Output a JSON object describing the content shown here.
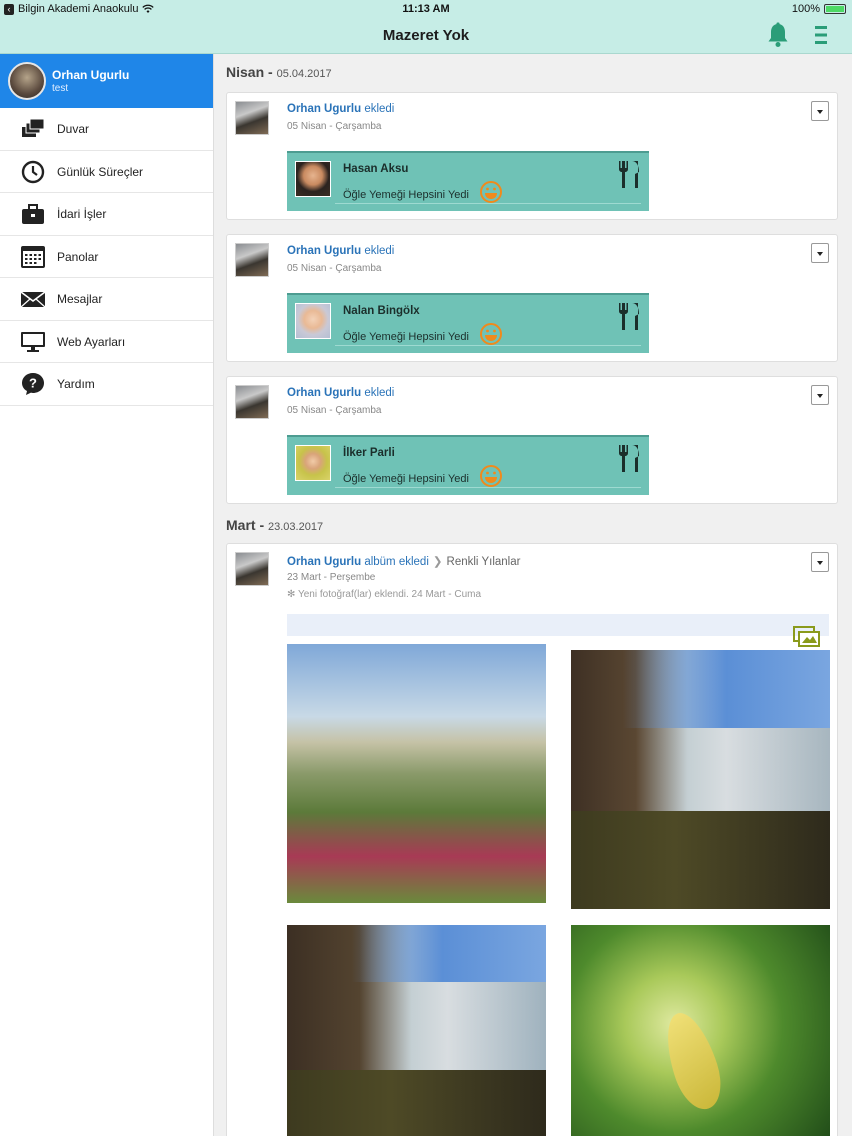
{
  "status_bar": {
    "back_text": "Bilgin Akademi Anaokulu",
    "time": "11:13 AM",
    "battery": "100%"
  },
  "nav": {
    "title": "Mazeret Yok"
  },
  "profile": {
    "name": "Orhan Ugurlu",
    "subtitle": "test"
  },
  "sidebar": {
    "items": [
      {
        "label": "Duvar",
        "icon": "wall-icon"
      },
      {
        "label": "Günlük Süreçler",
        "icon": "clock-icon"
      },
      {
        "label": "İdari İşler",
        "icon": "briefcase-icon"
      },
      {
        "label": "Panolar",
        "icon": "calendar-icon"
      },
      {
        "label": "Mesajlar",
        "icon": "envelope-icon"
      },
      {
        "label": "Web Ayarları",
        "icon": "monitor-icon"
      },
      {
        "label": "Yardım",
        "icon": "help-icon"
      }
    ]
  },
  "feed": {
    "sections": [
      {
        "month": "Nisan",
        "sep": " - ",
        "date": "05.04.2017"
      },
      {
        "month": "Mart",
        "sep": " - ",
        "date": "23.03.2017"
      }
    ],
    "posts": [
      {
        "author": "Orhan Ugurlu",
        "action": " ekledi",
        "when": "05 Nisan - Çarşamba",
        "child": "Hasan Aksu",
        "status": "Öğle Yemeği Hepsini Yedi"
      },
      {
        "author": "Orhan Ugurlu",
        "action": " ekledi",
        "when": "05 Nisan - Çarşamba",
        "child": "Nalan Bingölx",
        "status": "Öğle Yemeği Hepsini Yedi"
      },
      {
        "author": "Orhan Ugurlu",
        "action": " ekledi",
        "when": "05 Nisan - Çarşamba",
        "child": "İlker Parli",
        "status": "Öğle Yemeği Hepsini Yedi"
      }
    ],
    "album_post": {
      "author": "Orhan Ugurlu",
      "action": " albüm ekledi",
      "album_name": "Renkli Yılanlar",
      "when": "23 Mart - Perşembe",
      "note": "✻ Yeni fotoğraf(lar) eklendi. 24 Mart - Cuma"
    }
  },
  "colors": {
    "bar_bg": "#c6ede6",
    "profile_bg": "#1f86e8",
    "meal_bg": "#6fc2b6",
    "link": "#2a73b8",
    "bell": "#2a9d78",
    "smile": "#f08a1c"
  }
}
